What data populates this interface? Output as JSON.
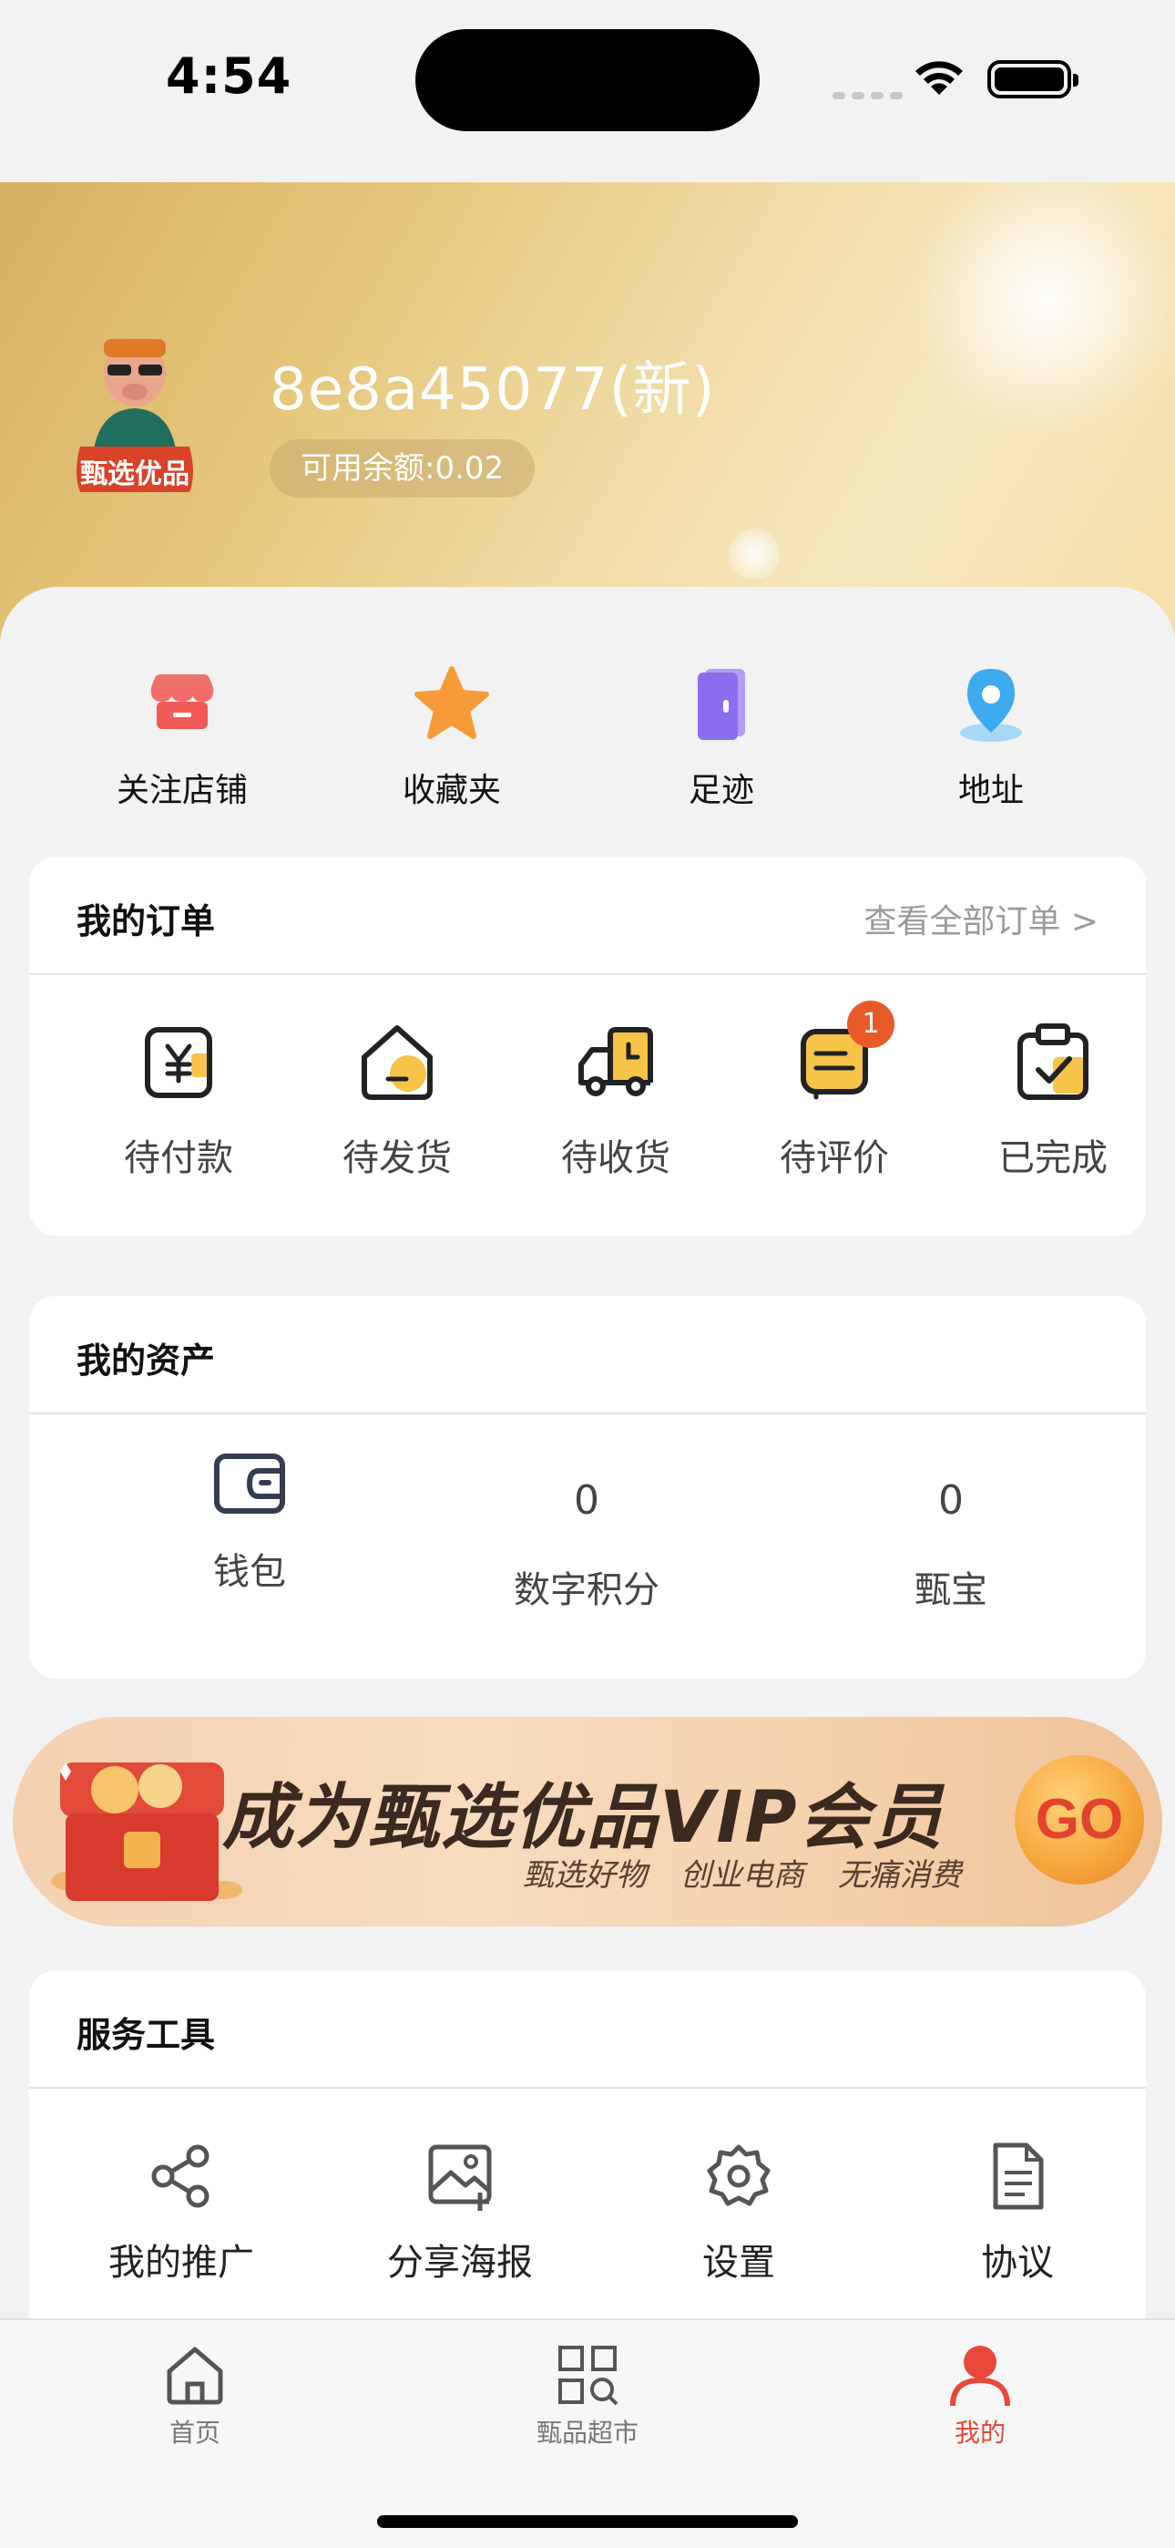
{
  "status_bar": {
    "time": "4:54"
  },
  "profile": {
    "username": "8e8a45077(新)",
    "balance": "可用余额:0.02",
    "avatar_text": "甄选优品"
  },
  "quick_links": [
    {
      "label": "关注店铺",
      "icon": "store-icon"
    },
    {
      "label": "收藏夹",
      "icon": "star-icon"
    },
    {
      "label": "足迹",
      "icon": "footprint-icon"
    },
    {
      "label": "地址",
      "icon": "location-pin-icon"
    }
  ],
  "orders": {
    "title": "我的订单",
    "view_all": "查看全部订单 >",
    "items": [
      {
        "label": "待付款",
        "icon": "yen-wallet-icon"
      },
      {
        "label": "待发货",
        "icon": "house-box-icon"
      },
      {
        "label": "待收货",
        "icon": "truck-icon"
      },
      {
        "label": "待评价",
        "icon": "review-icon",
        "badge": "1"
      },
      {
        "label": "已完成",
        "icon": "clipboard-check-icon"
      }
    ]
  },
  "assets": {
    "title": "我的资产",
    "items": [
      {
        "label": "钱包",
        "icon": "wallet-icon"
      },
      {
        "label": "数字积分",
        "value": "0"
      },
      {
        "label": "甄宝",
        "value": "0"
      }
    ]
  },
  "vip_banner": {
    "title": "成为甄选优品VIP会员",
    "subtitle": "甄选好物 创业电商 无痛消费",
    "cta": "GO"
  },
  "tools": {
    "title": "服务工具",
    "items": [
      {
        "label": "我的推广",
        "icon": "share-icon"
      },
      {
        "label": "分享海报",
        "icon": "image-add-icon"
      },
      {
        "label": "设置",
        "icon": "gear-icon"
      },
      {
        "label": "协议",
        "icon": "document-icon"
      }
    ]
  },
  "tabbar": {
    "items": [
      {
        "label": "首页",
        "icon": "home-icon",
        "active": false
      },
      {
        "label": "甄品超市",
        "icon": "grid-search-icon",
        "active": false
      },
      {
        "label": "我的",
        "icon": "user-icon",
        "active": true
      }
    ]
  },
  "colors": {
    "accent": "#e8473a",
    "gold": "#e6c87d",
    "badge": "#e85a2a"
  }
}
